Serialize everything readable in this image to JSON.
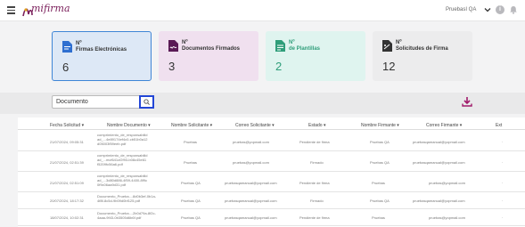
{
  "header": {
    "logo_text": "mifirma",
    "user_name": "PruebasI QA"
  },
  "cards": [
    {
      "line1": "Nº",
      "line2": "Firmas Electrónicas",
      "count": "6"
    },
    {
      "line1": "Nº",
      "line2": "Documentos Firmados",
      "count": "3"
    },
    {
      "line1": "Nº",
      "line2": "de Plantillas",
      "count": "2"
    },
    {
      "line1": "Nº",
      "line2": "Solicitudes de Firma",
      "count": "12"
    }
  ],
  "search": {
    "value": "Documento"
  },
  "table": {
    "headers": [
      "Fecha Solicitud",
      "Nombre Documento",
      "Nombre Solicitante",
      "Correo Solicitante",
      "Estado",
      "Nombre Firmante",
      "Correo Firmante",
      "Ext"
    ],
    "rows": [
      {
        "fecha": "21/07/2024, 09:05:31",
        "doc": "comprimiento_de_responsabilid ad_...4e89174ef4c0-cb51b0a12 d05003f59eeb.pdf",
        "solicitante": "Pruebas",
        "correo": "pruebas@yopmail.com",
        "estado": "Pendiente de firma",
        "firmante": "Pruebas QA",
        "correo_firmante": "pruebasqamanual@yopmail.com"
      },
      {
        "fecha": "21/07/2024, 02:51:39",
        "doc": "comprimiento_de_responsabilid ad_...mcf641cf2f93-b08c45e61 f5209fc56a6.pdf",
        "solicitante": "Pruebas",
        "correo": "pruebas@yopmail.com",
        "estado": "Firmado",
        "firmante": "Pruebas QA",
        "correo_firmante": "pruebasqamanual@yopmail.com"
      },
      {
        "fecha": "21/07/2024, 02:51:09",
        "doc": "comprimiento_de_responsabilid ad_...3d80d886-4f59-4400-8f9c 0f9c06aa9d31.pdf",
        "solicitante": "Pruebas QA",
        "correo": "pruebasqamanual@yopmail.com",
        "estado": "Pendiente de firma",
        "firmante": "Pruebas",
        "correo_firmante": "pruebas@yopmail.com"
      },
      {
        "fecha": "20/07/2024, 18:17:32",
        "doc": "Documento_Prueba....8d0b3ef-0b1a-4f8f-8c5d-9b09d0bf125.pdf",
        "solicitante": "Pruebas QA",
        "correo": "pruebasqamanual@yopmail.com",
        "estado": "Firmado",
        "firmante": "Pruebas QA",
        "correo_firmante": "pruebasqamanual@yopmail.com"
      },
      {
        "fecha": "18/07/2024, 10:02:31",
        "doc": "Documento_Prueba....2b0d79a-8f2c-4aaa-9f43-0b3505d6b6f.pdf",
        "solicitante": "Pruebas QA",
        "correo": "pruebasqamanual@yopmail.com",
        "estado": "Pendiente de firma",
        "firmante": "Pruebas",
        "correo_firmante": "pruebas@yopmail.com"
      }
    ]
  },
  "colors": {
    "brand": "#7a1e5a",
    "card_active_border": "#3f86d6",
    "search_button_border": "#2346d6",
    "accent": "#a01a6a"
  }
}
